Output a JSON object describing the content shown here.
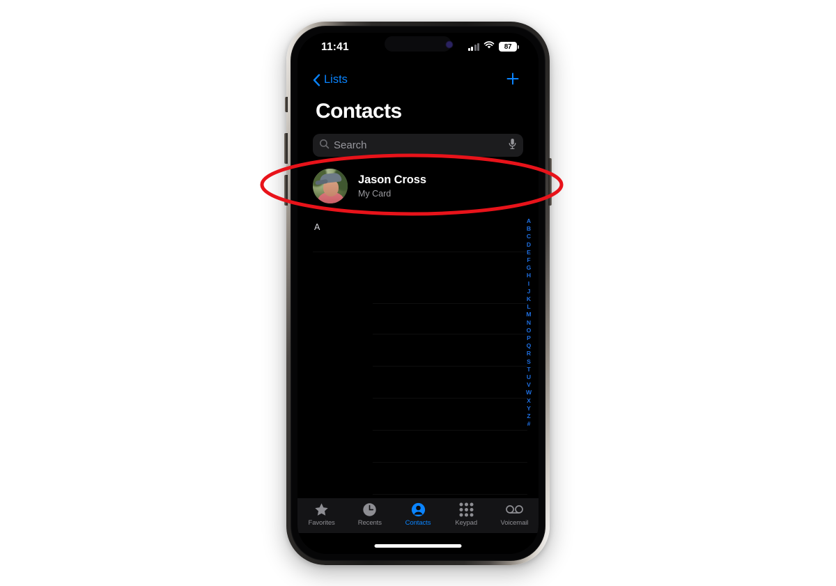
{
  "device": {
    "name": "iphone-frame",
    "status_bar": {
      "time": "11:41",
      "battery_percent": "87",
      "cellular_icon": "cellular-signal-icon",
      "wifi_icon": "wifi-icon",
      "battery_icon": "battery-icon",
      "dynamic_island": "dynamic-island"
    },
    "home_indicator": "home-indicator"
  },
  "nav": {
    "back_label": "Lists",
    "back_icon": "chevron-left-icon",
    "add_icon": "plus-icon"
  },
  "header": {
    "title": "Contacts"
  },
  "search": {
    "placeholder": "Search",
    "value": "",
    "search_icon": "search-icon",
    "mic_icon": "microphone-icon"
  },
  "my_card": {
    "name": "Jason Cross",
    "subtitle": "My Card",
    "avatar": "contact-photo"
  },
  "list": {
    "section_header": "A",
    "row_offsets": [
      22,
      96,
      140,
      186,
      232,
      278,
      324,
      370,
      414,
      460,
      506
    ]
  },
  "alphabet_index": [
    "A",
    "B",
    "C",
    "D",
    "E",
    "F",
    "G",
    "H",
    "I",
    "J",
    "K",
    "L",
    "M",
    "N",
    "O",
    "P",
    "Q",
    "R",
    "S",
    "T",
    "U",
    "V",
    "W",
    "X",
    "Y",
    "Z",
    "#"
  ],
  "tabs": [
    {
      "label": "Favorites",
      "icon": "star-icon",
      "active": false
    },
    {
      "label": "Recents",
      "icon": "clock-icon",
      "active": false
    },
    {
      "label": "Contacts",
      "icon": "person-circle-icon",
      "active": true
    },
    {
      "label": "Keypad",
      "icon": "keypad-grid-icon",
      "active": false
    },
    {
      "label": "Voicemail",
      "icon": "voicemail-icon",
      "active": false
    }
  ],
  "annotation": {
    "type": "ellipse-highlight",
    "color": "#e8131a",
    "target": "my-card-row"
  },
  "colors": {
    "accent_blue": "#0a84ff",
    "index_blue": "#1f6fe0",
    "annotation_red": "#e8131a",
    "screen_black": "#000000",
    "search_bg": "#1c1c1e",
    "tabbar_bg": "#141416",
    "secondary_text": "#9b9ba0",
    "inactive_tab": "#8e8e93"
  }
}
